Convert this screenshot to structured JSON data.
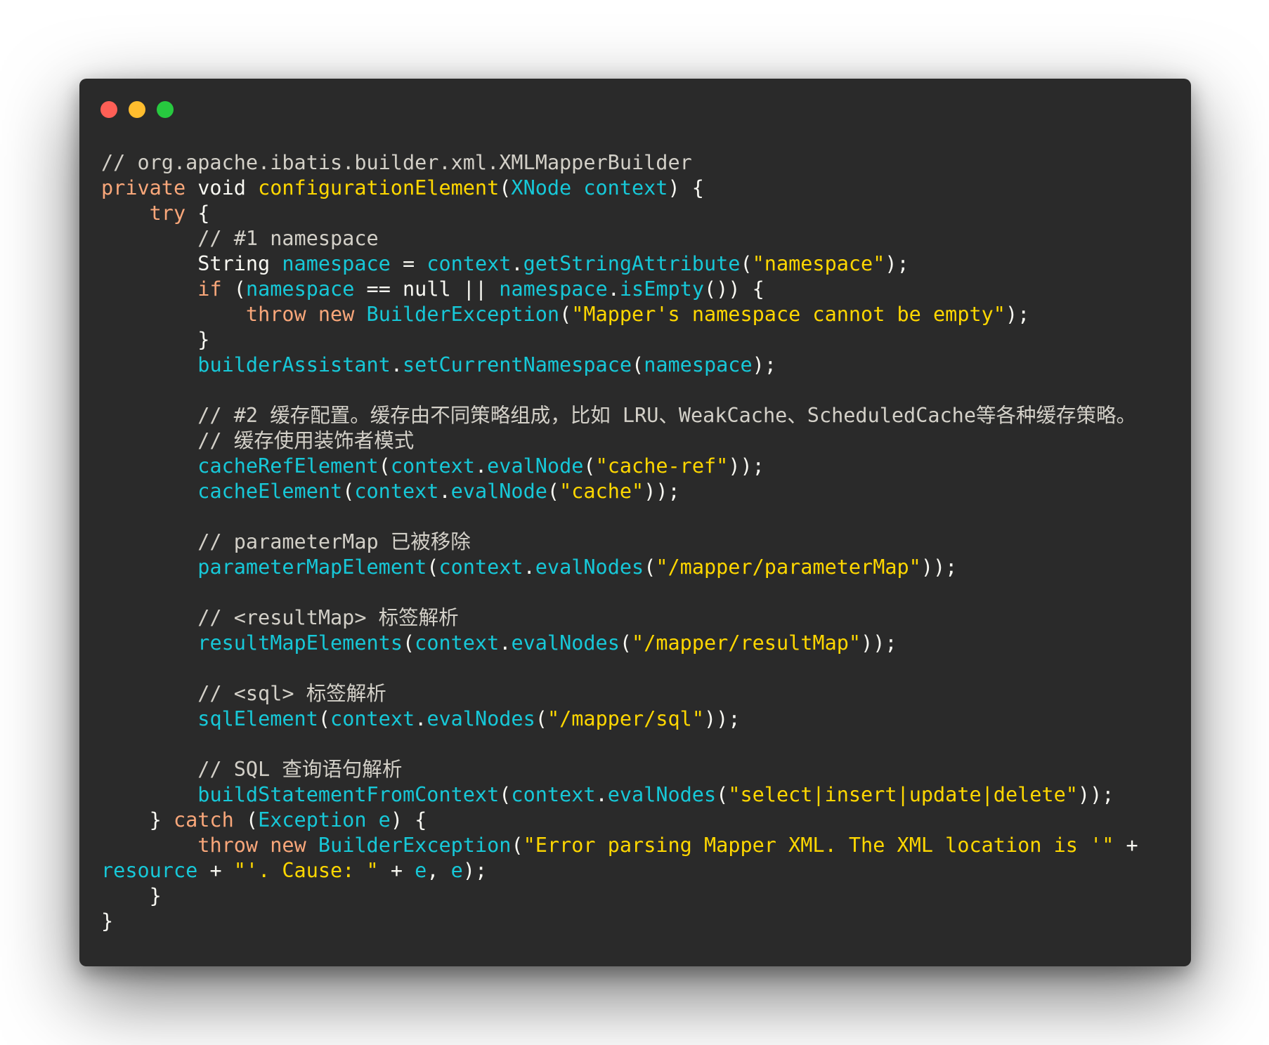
{
  "window": {
    "controls": {
      "close_color": "#ff5f56",
      "minimize_color": "#ffbd2e",
      "zoom_color": "#27c93f"
    },
    "background": "#2a2a2a"
  },
  "colors": {
    "comment": "#d3d0c8",
    "keyword": "#f9a77a",
    "identifier": "#17c8d8",
    "string": "#ffd700",
    "plain": "#f8f8f2"
  },
  "code": {
    "lines": [
      [
        {
          "t": "// org.apache.ibatis.builder.xml.XMLMapperBuilder",
          "c": "comment"
        }
      ],
      [
        {
          "t": "private",
          "c": "kw"
        },
        {
          "t": " void ",
          "c": "ty"
        },
        {
          "t": "configurationElement",
          "c": "fn"
        },
        {
          "t": "(",
          "c": "pl"
        },
        {
          "t": "XNode context",
          "c": "id"
        },
        {
          "t": ") {",
          "c": "pl"
        }
      ],
      [
        {
          "t": "    ",
          "c": "pl"
        },
        {
          "t": "try",
          "c": "kw"
        },
        {
          "t": " {",
          "c": "pl"
        }
      ],
      [
        {
          "t": "        // #1 namespace",
          "c": "comment"
        }
      ],
      [
        {
          "t": "        String ",
          "c": "pl"
        },
        {
          "t": "namespace",
          "c": "id"
        },
        {
          "t": " = ",
          "c": "pl"
        },
        {
          "t": "context",
          "c": "id"
        },
        {
          "t": ".",
          "c": "pl"
        },
        {
          "t": "getStringAttribute",
          "c": "id"
        },
        {
          "t": "(",
          "c": "pl"
        },
        {
          "t": "\"namespace\"",
          "c": "st"
        },
        {
          "t": ");",
          "c": "pl"
        }
      ],
      [
        {
          "t": "        ",
          "c": "pl"
        },
        {
          "t": "if",
          "c": "kw"
        },
        {
          "t": " (",
          "c": "pl"
        },
        {
          "t": "namespace",
          "c": "id"
        },
        {
          "t": " == null || ",
          "c": "pl"
        },
        {
          "t": "namespace",
          "c": "id"
        },
        {
          "t": ".",
          "c": "pl"
        },
        {
          "t": "isEmpty",
          "c": "id"
        },
        {
          "t": "()) {",
          "c": "pl"
        }
      ],
      [
        {
          "t": "            ",
          "c": "pl"
        },
        {
          "t": "throw",
          "c": "kw"
        },
        {
          "t": " ",
          "c": "pl"
        },
        {
          "t": "new",
          "c": "kw"
        },
        {
          "t": " ",
          "c": "pl"
        },
        {
          "t": "BuilderException",
          "c": "id"
        },
        {
          "t": "(",
          "c": "pl"
        },
        {
          "t": "\"Mapper's namespace cannot be empty\"",
          "c": "st"
        },
        {
          "t": ");",
          "c": "pl"
        }
      ],
      [
        {
          "t": "        }",
          "c": "pl"
        }
      ],
      [
        {
          "t": "        ",
          "c": "pl"
        },
        {
          "t": "builderAssistant",
          "c": "id"
        },
        {
          "t": ".",
          "c": "pl"
        },
        {
          "t": "setCurrentNamespace",
          "c": "id"
        },
        {
          "t": "(",
          "c": "pl"
        },
        {
          "t": "namespace",
          "c": "id"
        },
        {
          "t": ");",
          "c": "pl"
        }
      ],
      [
        {
          "t": "",
          "c": "pl"
        }
      ],
      [
        {
          "t": "        // #2 缓存配置。缓存由不同策略组成，比如 LRU、WeakCache、ScheduledCache等各种缓存策略。",
          "c": "comment"
        }
      ],
      [
        {
          "t": "        // 缓存使用装饰者模式",
          "c": "comment"
        }
      ],
      [
        {
          "t": "        ",
          "c": "pl"
        },
        {
          "t": "cacheRefElement",
          "c": "id"
        },
        {
          "t": "(",
          "c": "pl"
        },
        {
          "t": "context",
          "c": "id"
        },
        {
          "t": ".",
          "c": "pl"
        },
        {
          "t": "evalNode",
          "c": "id"
        },
        {
          "t": "(",
          "c": "pl"
        },
        {
          "t": "\"cache-ref\"",
          "c": "st"
        },
        {
          "t": "));",
          "c": "pl"
        }
      ],
      [
        {
          "t": "        ",
          "c": "pl"
        },
        {
          "t": "cacheElement",
          "c": "id"
        },
        {
          "t": "(",
          "c": "pl"
        },
        {
          "t": "context",
          "c": "id"
        },
        {
          "t": ".",
          "c": "pl"
        },
        {
          "t": "evalNode",
          "c": "id"
        },
        {
          "t": "(",
          "c": "pl"
        },
        {
          "t": "\"cache\"",
          "c": "st"
        },
        {
          "t": "));",
          "c": "pl"
        }
      ],
      [
        {
          "t": "",
          "c": "pl"
        }
      ],
      [
        {
          "t": "        // parameterMap 已被移除",
          "c": "comment"
        }
      ],
      [
        {
          "t": "        ",
          "c": "pl"
        },
        {
          "t": "parameterMapElement",
          "c": "id"
        },
        {
          "t": "(",
          "c": "pl"
        },
        {
          "t": "context",
          "c": "id"
        },
        {
          "t": ".",
          "c": "pl"
        },
        {
          "t": "evalNodes",
          "c": "id"
        },
        {
          "t": "(",
          "c": "pl"
        },
        {
          "t": "\"/mapper/parameterMap\"",
          "c": "st"
        },
        {
          "t": "));",
          "c": "pl"
        }
      ],
      [
        {
          "t": "",
          "c": "pl"
        }
      ],
      [
        {
          "t": "        // <resultMap> 标签解析",
          "c": "comment"
        }
      ],
      [
        {
          "t": "        ",
          "c": "pl"
        },
        {
          "t": "resultMapElements",
          "c": "id"
        },
        {
          "t": "(",
          "c": "pl"
        },
        {
          "t": "context",
          "c": "id"
        },
        {
          "t": ".",
          "c": "pl"
        },
        {
          "t": "evalNodes",
          "c": "id"
        },
        {
          "t": "(",
          "c": "pl"
        },
        {
          "t": "\"/mapper/resultMap\"",
          "c": "st"
        },
        {
          "t": "));",
          "c": "pl"
        }
      ],
      [
        {
          "t": "",
          "c": "pl"
        }
      ],
      [
        {
          "t": "        // <sql> 标签解析",
          "c": "comment"
        }
      ],
      [
        {
          "t": "        ",
          "c": "pl"
        },
        {
          "t": "sqlElement",
          "c": "id"
        },
        {
          "t": "(",
          "c": "pl"
        },
        {
          "t": "context",
          "c": "id"
        },
        {
          "t": ".",
          "c": "pl"
        },
        {
          "t": "evalNodes",
          "c": "id"
        },
        {
          "t": "(",
          "c": "pl"
        },
        {
          "t": "\"/mapper/sql\"",
          "c": "st"
        },
        {
          "t": "));",
          "c": "pl"
        }
      ],
      [
        {
          "t": "",
          "c": "pl"
        }
      ],
      [
        {
          "t": "        // SQL 查询语句解析",
          "c": "comment"
        }
      ],
      [
        {
          "t": "        ",
          "c": "pl"
        },
        {
          "t": "buildStatementFromContext",
          "c": "id"
        },
        {
          "t": "(",
          "c": "pl"
        },
        {
          "t": "context",
          "c": "id"
        },
        {
          "t": ".",
          "c": "pl"
        },
        {
          "t": "evalNodes",
          "c": "id"
        },
        {
          "t": "(",
          "c": "pl"
        },
        {
          "t": "\"select|insert|update|delete\"",
          "c": "st"
        },
        {
          "t": "));",
          "c": "pl"
        }
      ],
      [
        {
          "t": "    } ",
          "c": "pl"
        },
        {
          "t": "catch",
          "c": "kw"
        },
        {
          "t": " (",
          "c": "pl"
        },
        {
          "t": "Exception e",
          "c": "id"
        },
        {
          "t": ") {",
          "c": "pl"
        }
      ],
      [
        {
          "t": "        ",
          "c": "pl"
        },
        {
          "t": "throw",
          "c": "kw"
        },
        {
          "t": " ",
          "c": "pl"
        },
        {
          "t": "new",
          "c": "kw"
        },
        {
          "t": " ",
          "c": "pl"
        },
        {
          "t": "BuilderException",
          "c": "id"
        },
        {
          "t": "(",
          "c": "pl"
        },
        {
          "t": "\"Error parsing Mapper XML. The XML location is '\"",
          "c": "st"
        },
        {
          "t": " +",
          "c": "pl"
        }
      ],
      [
        {
          "t": "resource",
          "c": "id"
        },
        {
          "t": " + ",
          "c": "pl"
        },
        {
          "t": "\"'. Cause: \"",
          "c": "st"
        },
        {
          "t": " + ",
          "c": "pl"
        },
        {
          "t": "e",
          "c": "id"
        },
        {
          "t": ", ",
          "c": "pl"
        },
        {
          "t": "e",
          "c": "id"
        },
        {
          "t": ");",
          "c": "pl"
        }
      ],
      [
        {
          "t": "    }",
          "c": "pl"
        }
      ],
      [
        {
          "t": "}",
          "c": "pl"
        }
      ]
    ]
  }
}
